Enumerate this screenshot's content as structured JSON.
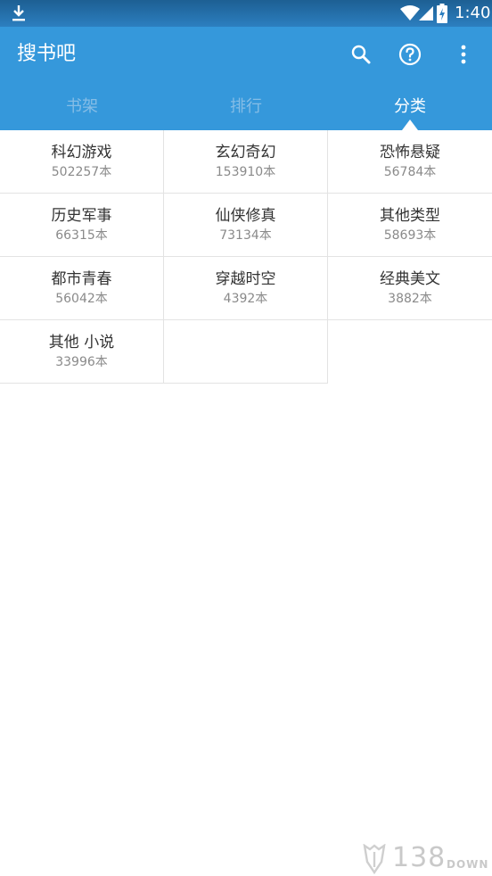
{
  "status_bar": {
    "time": "1:40",
    "icons": [
      "download-icon",
      "wifi-icon",
      "signal-icon",
      "battery-charging-icon"
    ]
  },
  "app_bar": {
    "title": "搜书吧",
    "actions": [
      "search-icon",
      "help-icon",
      "more-vert-icon"
    ],
    "color": "#3598db"
  },
  "tabs": [
    {
      "label": "书架",
      "active": false
    },
    {
      "label": "排行",
      "active": false
    },
    {
      "label": "分类",
      "active": true
    }
  ],
  "categories": [
    {
      "name": "科幻游戏",
      "count": "502257本"
    },
    {
      "name": "玄幻奇幻",
      "count": "153910本"
    },
    {
      "name": "恐怖悬疑",
      "count": "56784本"
    },
    {
      "name": "历史军事",
      "count": "66315本"
    },
    {
      "name": "仙侠修真",
      "count": "73134本"
    },
    {
      "name": "其他类型",
      "count": "58693本"
    },
    {
      "name": "都市青春",
      "count": "56042本"
    },
    {
      "name": "穿越时空",
      "count": "4392本"
    },
    {
      "name": "经典美文",
      "count": "3882本"
    },
    {
      "name": "其他 小说",
      "count": "33996本"
    }
  ],
  "watermark": {
    "number": "138",
    "suffix": "DOWN"
  }
}
